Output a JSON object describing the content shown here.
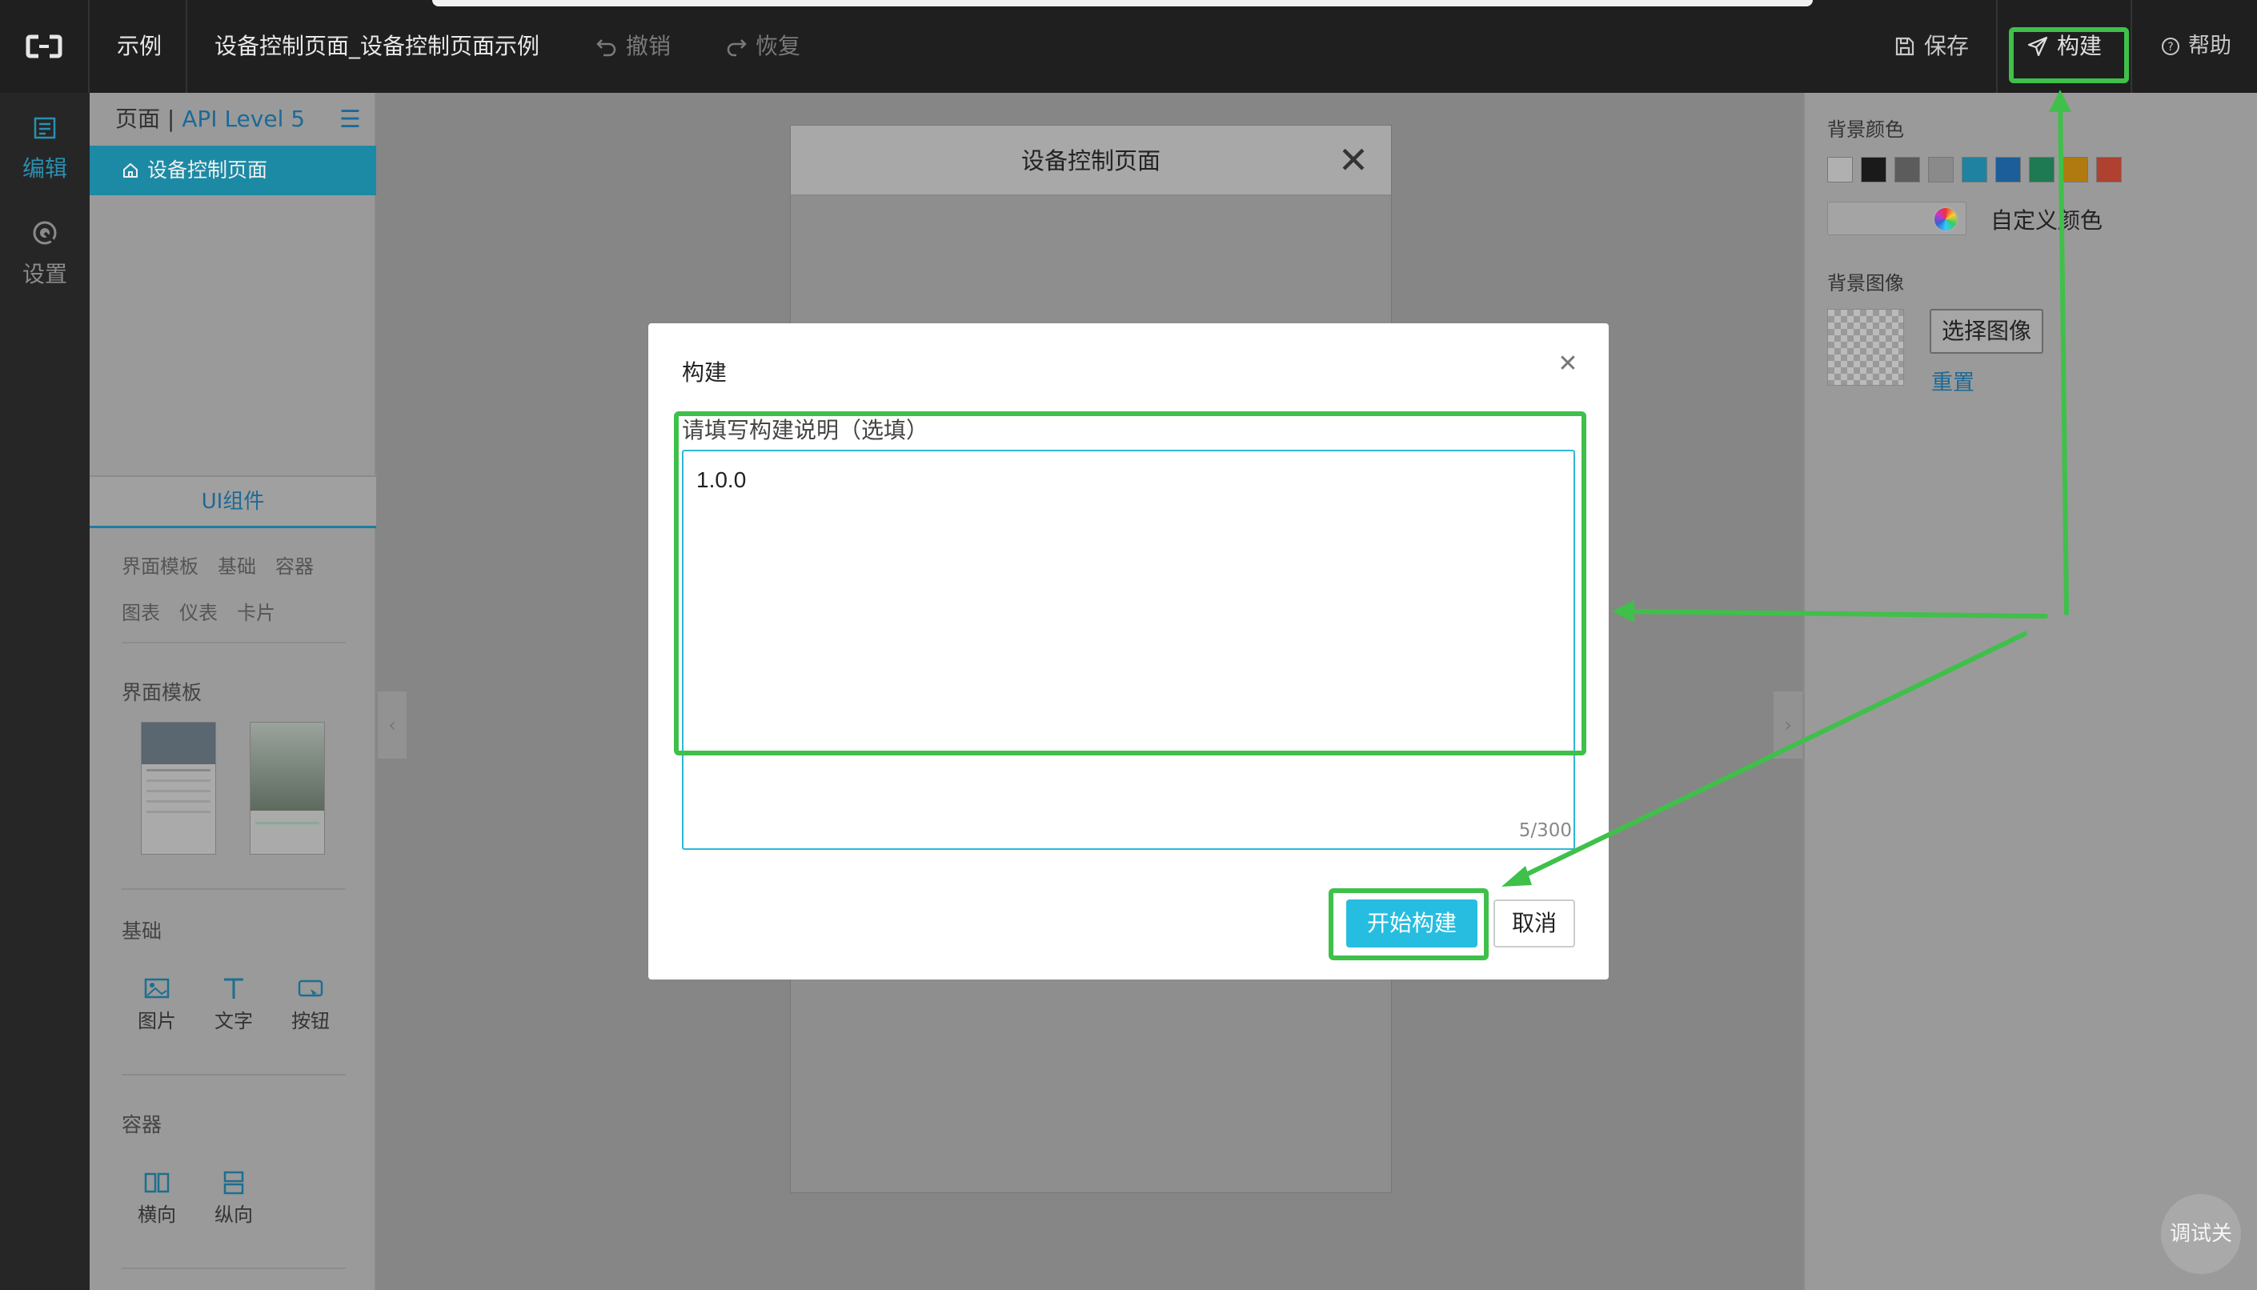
{
  "topbar": {
    "example_label": "示例",
    "page_title": "设备控制页面_设备控制页面示例",
    "undo_label": "撤销",
    "redo_label": "恢复",
    "save_label": "保存",
    "build_label": "构建",
    "help_label": "帮助"
  },
  "leftnav": {
    "items": [
      {
        "label": "编辑",
        "icon": "edit-icon",
        "active": true
      },
      {
        "label": "设置",
        "icon": "settings-icon",
        "active": false
      }
    ]
  },
  "leftpanel": {
    "pages_label": "页面 | ",
    "api_level": "API Level 5",
    "page_item": "设备控制页面",
    "ui_tab": "UI组件",
    "categories": [
      "界面模板",
      "基础",
      "容器",
      "图表",
      "仪表",
      "卡片"
    ],
    "templates_title": "界面模板",
    "basic_title": "基础",
    "basic_items": [
      "图片",
      "文字",
      "按钮"
    ],
    "container_title": "容器",
    "container_items": [
      "横向",
      "纵向"
    ]
  },
  "canvas": {
    "phone_title": "设备控制页面"
  },
  "rightpanel": {
    "bg_color_label": "背景颜色",
    "swatches": [
      "#b0b0b0",
      "#1a1a1a",
      "#5c5c5c",
      "#8a8a8a",
      "#1e82a0",
      "#1c5e9a",
      "#1e7a52",
      "#b07a10",
      "#b04030"
    ],
    "custom_color_label": "自定义颜色",
    "bg_image_label": "背景图像",
    "select_image_label": "选择图像",
    "reset_label": "重置"
  },
  "modal": {
    "title": "构建",
    "field_label": "请填写构建说明（选填）",
    "description_value": "1.0.0",
    "counter": "5/300",
    "start_button": "开始构建",
    "cancel_button": "取消"
  },
  "debug_button": "调试关",
  "colors": {
    "accent": "#27bde0",
    "annotation": "#3fc04a",
    "topbar": "#1f1f20"
  }
}
